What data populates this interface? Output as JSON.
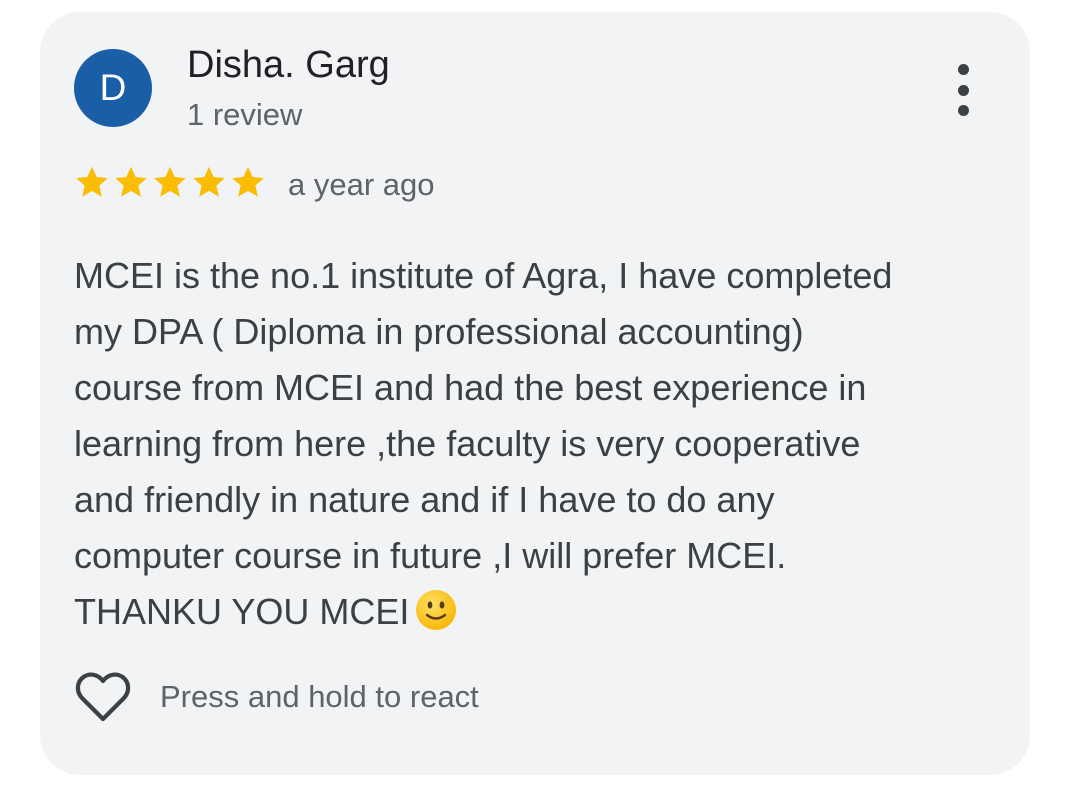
{
  "review": {
    "author": {
      "initial": "D",
      "name": "Disha. Garg",
      "review_count": "1 review",
      "avatar_color": "#1a5ea8"
    },
    "rating": {
      "stars": 5,
      "max": 5,
      "star_color": "#fbbc04"
    },
    "timestamp": "a year ago",
    "text_lines": [
      "MCEI is the no.1 institute of Agra, I have completed",
      "my DPA ( Diploma in professional accounting)",
      "course from MCEI and had the best experience in",
      "learning from here ,the faculty is very cooperative",
      "and friendly in nature and if I have to do any",
      "computer course in future ,I will prefer MCEI.",
      "THANKU YOU MCEI"
    ],
    "emoji": "slightly-smiling-face-emoji",
    "menu_icon": "more-vert-icon"
  },
  "reaction": {
    "icon": "heart-outline-icon",
    "label": "Press and hold to react"
  }
}
